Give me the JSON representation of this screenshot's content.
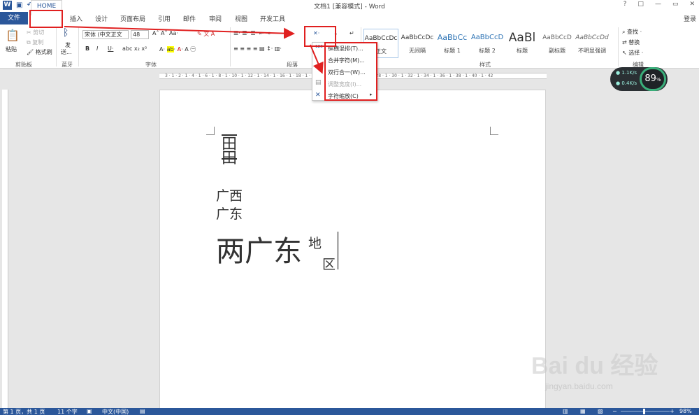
{
  "title": "文档1 [兼容模式] - Word",
  "window_controls": [
    "?",
    "□",
    "—",
    "▭",
    "✕"
  ],
  "tabs": {
    "file": "文件",
    "home": "HOME",
    "insert": "插入",
    "design": "设计",
    "layout": "页面布局",
    "references": "引用",
    "mailings": "邮件",
    "review": "审阅",
    "view": "视图",
    "developer": "开发工具"
  },
  "login": "登录",
  "clipboard": {
    "paste": "粘贴",
    "cut": "剪切",
    "copy": "复制",
    "format_painter": "格式刷",
    "group": "剪贴板"
  },
  "bluetooth": {
    "send": "发",
    "send2": "送...",
    "group": "蓝牙"
  },
  "font": {
    "name": "宋体 (中文正文",
    "size": "48",
    "group": "字体"
  },
  "paragraph": {
    "group": "段落"
  },
  "styles": {
    "items": [
      {
        "sample": "AaBbCcDc",
        "name": "正文"
      },
      {
        "sample": "AaBbCcDc",
        "name": "无间隔"
      },
      {
        "sample": "AaBbCc",
        "name": "标题 1"
      },
      {
        "sample": "AaBbCcD",
        "name": "标题 2"
      },
      {
        "sample": "AaBl",
        "name": "标题"
      },
      {
        "sample": "AaBbCcD",
        "name": "副标题"
      },
      {
        "sample": "AaBbCcDd",
        "name": "不明显强调"
      }
    ],
    "group": "样式"
  },
  "editing": {
    "find": "查找",
    "replace": "替换",
    "select": "选择",
    "group": "编辑"
  },
  "dropdown": {
    "items": [
      "纵横混排(T)...",
      "合并字符(M)...",
      "双行合一(W)...",
      "调整宽度(I)...",
      "字符缩放(C)"
    ]
  },
  "document": {
    "combined_top": "田",
    "combined_bottom": "田",
    "line1": "广西",
    "line2": "广东",
    "main_text": "两广东",
    "two_line_top": "地",
    "two_line_bottom": "区"
  },
  "network": {
    "up": "1.1K/s",
    "down": "0.4K/s",
    "percent": "89"
  },
  "status": {
    "page": "第 1 页，共 1 页",
    "words": "11 个字",
    "lang": "中文(中国)",
    "zoom": "98%"
  },
  "watermark": {
    "brand": "Bai du 经验",
    "url": "jingyan.baidu.com"
  },
  "colors": {
    "accent": "#2b579a",
    "highlight": "#e02020",
    "status_bar": "#2b579a"
  }
}
